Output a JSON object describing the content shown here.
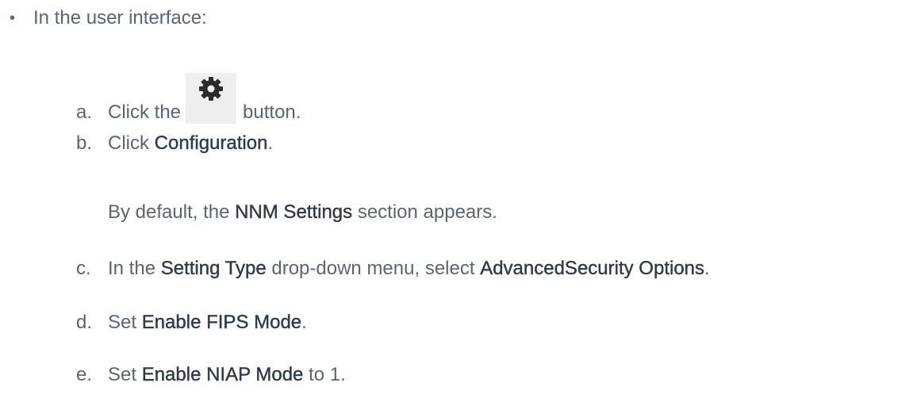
{
  "intro": "In the user interface:",
  "steps": {
    "a": {
      "letter": "a.",
      "before": "Click the",
      "icon": "gear-icon",
      "after": "button."
    },
    "b": {
      "letter": "b.",
      "before": "Click ",
      "bold": "Configuration",
      "after": "."
    },
    "b_note": {
      "before": "By default, the ",
      "bold": "NNM Settings",
      "after": " section appears."
    },
    "c": {
      "letter": "c.",
      "before": "In the ",
      "bold1": "Setting Type",
      "middle": " drop-down menu, select ",
      "bold2": "AdvancedSecurity Options",
      "after": "."
    },
    "d": {
      "letter": "d.",
      "before": "Set ",
      "bold": "Enable FIPS Mode",
      "after": "."
    },
    "e": {
      "letter": "e.",
      "before": "Set ",
      "bold": "Enable NIAP Mode",
      "after": " to 1."
    }
  }
}
